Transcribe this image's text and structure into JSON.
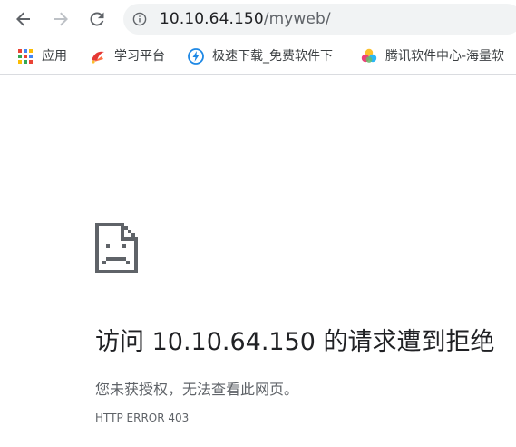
{
  "browser": {
    "address_bar": {
      "host": "10.10.64.150",
      "path": "/myweb/"
    },
    "bookmarks": [
      {
        "label": "应用",
        "icon": "apps-grid-icon"
      },
      {
        "label": "学习平台",
        "icon": "study-platform-icon"
      },
      {
        "label": "极速下载_免费软件下",
        "icon": "lightning-download-icon"
      },
      {
        "label": "腾讯软件中心-海量软",
        "icon": "tencent-software-icon"
      }
    ]
  },
  "error_page": {
    "heading": "访问 10.10.64.150 的请求遭到拒绝",
    "message": "您未获授权，无法查看此网页。",
    "code": "HTTP ERROR 403",
    "icon": "sad-page-icon"
  },
  "colors": {
    "toolbar_bg": "#ffffff",
    "omnibox_bg": "#f1f3f4",
    "text_primary": "#202124",
    "text_secondary": "#5f6368"
  }
}
